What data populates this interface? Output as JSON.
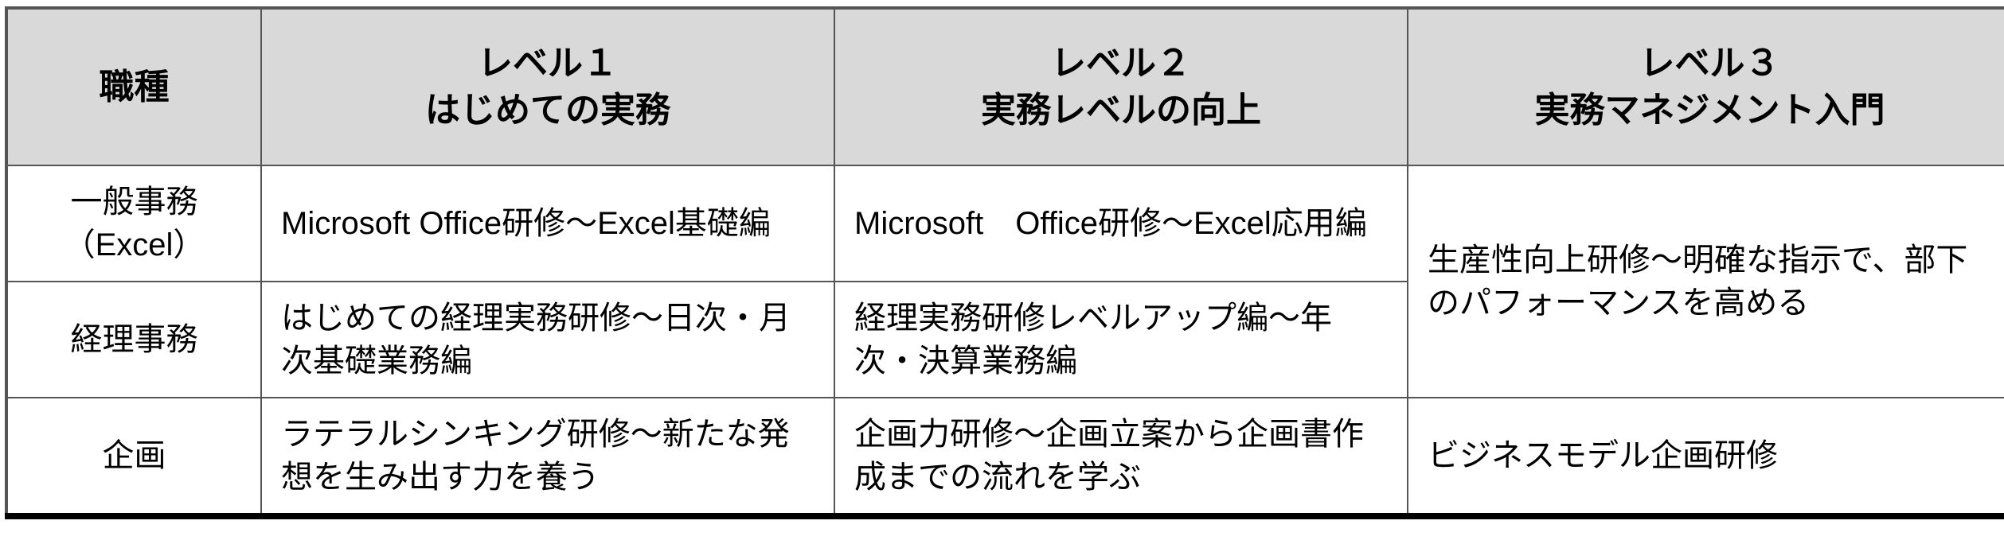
{
  "table": {
    "headers": [
      "職種",
      "レベル１\nはじめての実務",
      "レベル２\n実務レベルの向上",
      "レベル３\n実務マネジメント入門"
    ],
    "rows": [
      {
        "job": "一般事務（Excel）",
        "level1": "Microsoft Office研修～Excel基礎編",
        "level2": "Microsoft　Office研修～Excel応用編"
      },
      {
        "job": "経理事務",
        "level1": "はじめての経理実務研修～日次・月次基礎業務編",
        "level2": "経理実務研修レベルアップ編～年次・決算業務編"
      },
      {
        "job": "企画",
        "level1": "ラテラルシンキング研修～新たな発想を生み出す力を養う",
        "level2": "企画力研修～企画立案から企画書作成までの流れを学ぶ",
        "level3": "ビジネスモデル企画研修"
      }
    ],
    "merged_level3_rows_0_1": "生産性向上研修～明確な指示で、部下のパフォーマンスを高める"
  }
}
